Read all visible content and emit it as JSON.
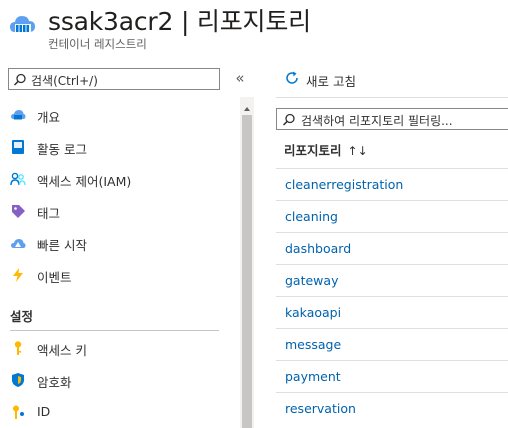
{
  "header": {
    "title": "ssak3acr2 | 리포지토리",
    "subtitle": "컨테이너 레지스트리"
  },
  "left_nav": {
    "search_placeholder": "검색(Ctrl+/)",
    "collapse_glyph": "«",
    "items": [
      {
        "label": "개요",
        "icon": "cloud-overview-icon"
      },
      {
        "label": "활동 로그",
        "icon": "activity-log-icon"
      },
      {
        "label": "액세스 제어(IAM)",
        "icon": "people-icon"
      },
      {
        "label": "태그",
        "icon": "tag-icon"
      },
      {
        "label": "빠른 시작",
        "icon": "quickstart-cloud-icon"
      },
      {
        "label": "이벤트",
        "icon": "lightning-icon"
      }
    ],
    "section_settings": "설정",
    "settings_items": [
      {
        "label": "액세스 키",
        "icon": "key-icon"
      },
      {
        "label": "암호화",
        "icon": "shield-icon"
      },
      {
        "label": "ID",
        "icon": "identity-key-icon"
      }
    ]
  },
  "main": {
    "refresh_label": "새로 고침",
    "filter_placeholder": "검색하여 리포지토리 필터링...",
    "column_header": "리포지토리",
    "sort_glyph": "↑↓",
    "repositories": [
      "cleanerregistration",
      "cleaning",
      "dashboard",
      "gateway",
      "kakaoapi",
      "message",
      "payment",
      "reservation"
    ]
  },
  "colors": {
    "link": "#0062ad",
    "accent_blue": "#0078d4"
  }
}
